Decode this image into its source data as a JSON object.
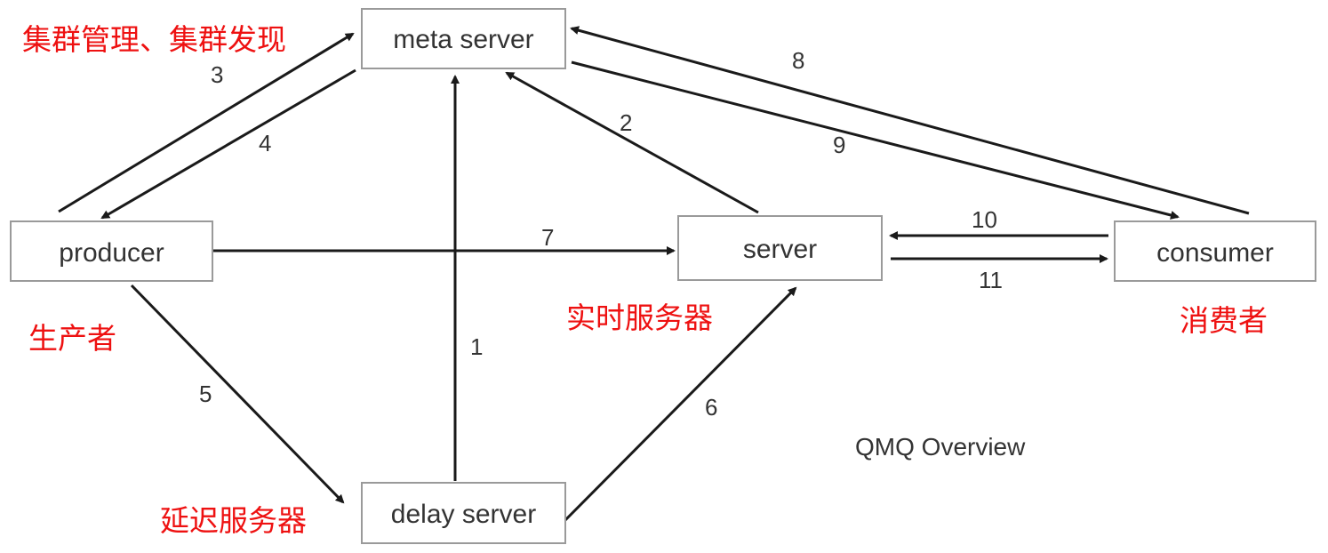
{
  "nodes": {
    "meta_server": "meta server",
    "producer": "producer",
    "server": "server",
    "consumer": "consumer",
    "delay_server": "delay server"
  },
  "edges": {
    "e1": "1",
    "e2": "2",
    "e3": "3",
    "e4": "4",
    "e5": "5",
    "e6": "6",
    "e7": "7",
    "e8": "8",
    "e9": "9",
    "e10": "10",
    "e11": "11"
  },
  "annotations": {
    "meta_server": "集群管理、集群发现",
    "producer": "生产者",
    "server": "实时服务器",
    "consumer": "消费者",
    "delay_server": "延迟服务器"
  },
  "caption": "QMQ Overview",
  "colors": {
    "annotation": "#ee1111",
    "edge": "#1a1a1a",
    "box_border": "#9a9a9a"
  }
}
